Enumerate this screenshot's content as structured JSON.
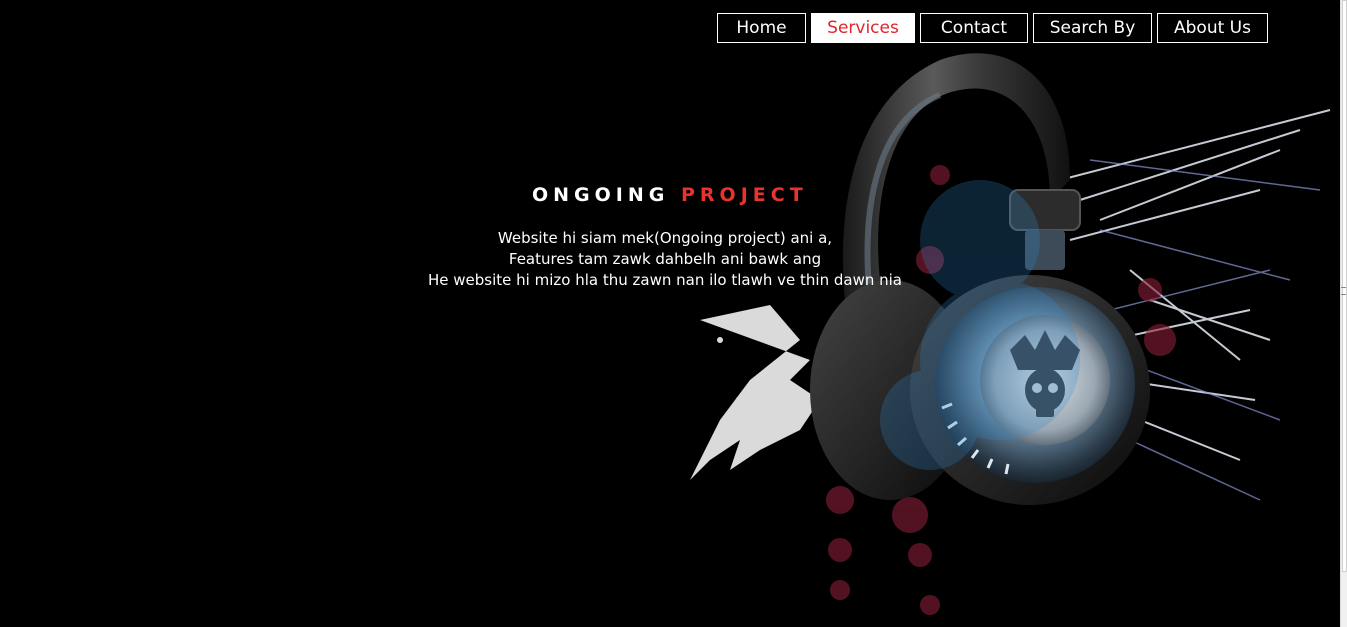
{
  "nav": {
    "items": [
      {
        "label": "Home",
        "active": false
      },
      {
        "label": "Services",
        "active": true
      },
      {
        "label": "Contact",
        "active": false
      },
      {
        "label": "Search By",
        "active": false
      },
      {
        "label": "About Us",
        "active": false
      }
    ]
  },
  "hero": {
    "title_part1": "ONGOING",
    "title_part2": "PROJECT",
    "lines": [
      "Website hi siam mek(Ongoing project) ani a,",
      "Features tam zawk dahbelh ani bawk ang",
      "He website hi mizo hla thu zawn nan ilo tlawh ve thin dawn nia"
    ]
  },
  "colors": {
    "background": "#000000",
    "accent": "#e8342c",
    "nav_border": "#ffffff"
  },
  "artwork": {
    "icon": "headphones-icon"
  }
}
